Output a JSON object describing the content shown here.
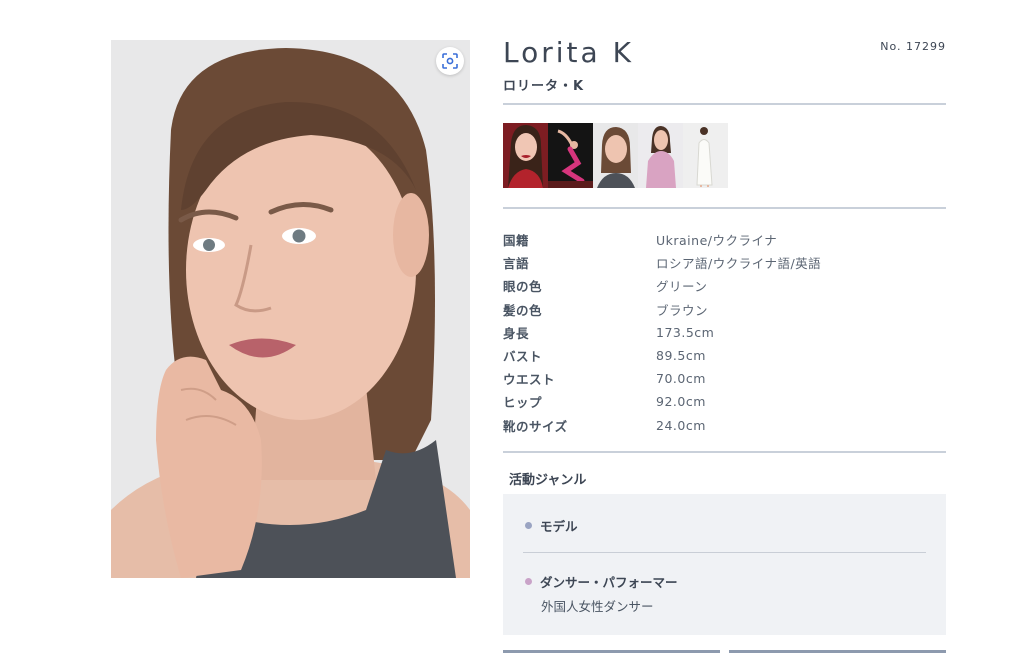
{
  "model": {
    "name_en": "Lorita K",
    "name_ja": "ロリータ・K",
    "number": "No. 17299"
  },
  "icons": {
    "zoom": "focus-scan-icon"
  },
  "thumbnails": [
    {
      "id": "thumb-1",
      "label": "portrait red dress"
    },
    {
      "id": "thumb-2",
      "label": "dance pose pink"
    },
    {
      "id": "thumb-3",
      "label": "headshot tank top"
    },
    {
      "id": "thumb-4",
      "label": "pink sweater"
    },
    {
      "id": "thumb-5",
      "label": "white dress full body"
    }
  ],
  "profile": [
    {
      "label": "国籍",
      "value": "Ukraine/ウクライナ"
    },
    {
      "label": "言語",
      "value": "ロシア語/ウクライナ語/英語"
    },
    {
      "label": "眼の色",
      "value": "グリーン"
    },
    {
      "label": "髪の色",
      "value": "ブラウン"
    },
    {
      "label": "身長",
      "value": "173.5cm"
    },
    {
      "label": "バスト",
      "value": "89.5cm"
    },
    {
      "label": "ウエスト",
      "value": "70.0cm"
    },
    {
      "label": "ヒップ",
      "value": "92.0cm"
    },
    {
      "label": "靴のサイズ",
      "value": "24.0cm"
    }
  ],
  "genre": {
    "title": "活動ジャンル",
    "items": [
      {
        "label": "モデル",
        "dot_color": "#9aa4c2",
        "sub": ""
      },
      {
        "label": "ダンサー・パフォーマー",
        "dot_color": "#c9a3c8",
        "sub": "外国人女性ダンサー"
      }
    ]
  },
  "colors": {
    "text_dark": "#3d4654",
    "rule": "#c9d0da",
    "genre_bg": "#f0f2f5"
  }
}
